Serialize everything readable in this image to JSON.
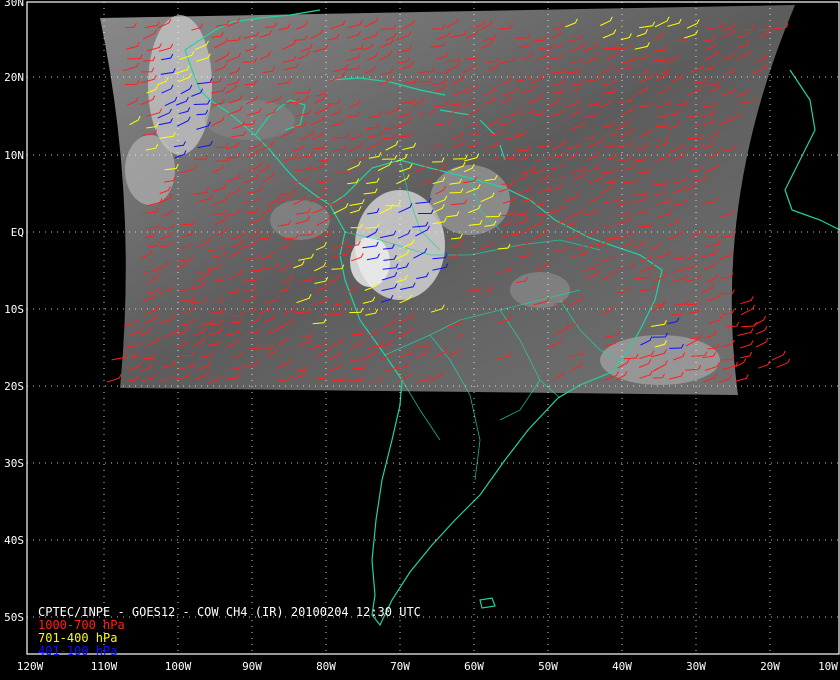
{
  "caption": {
    "title": "CPTEC/INPE - GOES12 - COW CH4 (IR) 20100204 12:30 UTC",
    "legend": [
      {
        "text": "1000-700 hPa",
        "color": "#ff2020"
      },
      {
        "text": "701-400 hPa",
        "color": "#ffff00"
      },
      {
        "text": "401-100 hPa",
        "color": "#1010ff"
      }
    ]
  },
  "lat_labels": [
    "30N",
    "20N",
    "10N",
    "EQ",
    "10S",
    "20S",
    "30S",
    "40S",
    "50S"
  ],
  "lon_labels": [
    "120W",
    "110W",
    "100W",
    "90W",
    "80W",
    "70W",
    "60W",
    "50W",
    "40W",
    "30W",
    "20W",
    "10W"
  ],
  "colors": {
    "background": "#000000",
    "grid": "#ffffff",
    "coastline": "#22d3a0",
    "satellite_image": "#6f6f6f",
    "low_level_winds": "#ff2020",
    "mid_level_winds": "#ffff00",
    "high_level_winds": "#1010ff"
  }
}
